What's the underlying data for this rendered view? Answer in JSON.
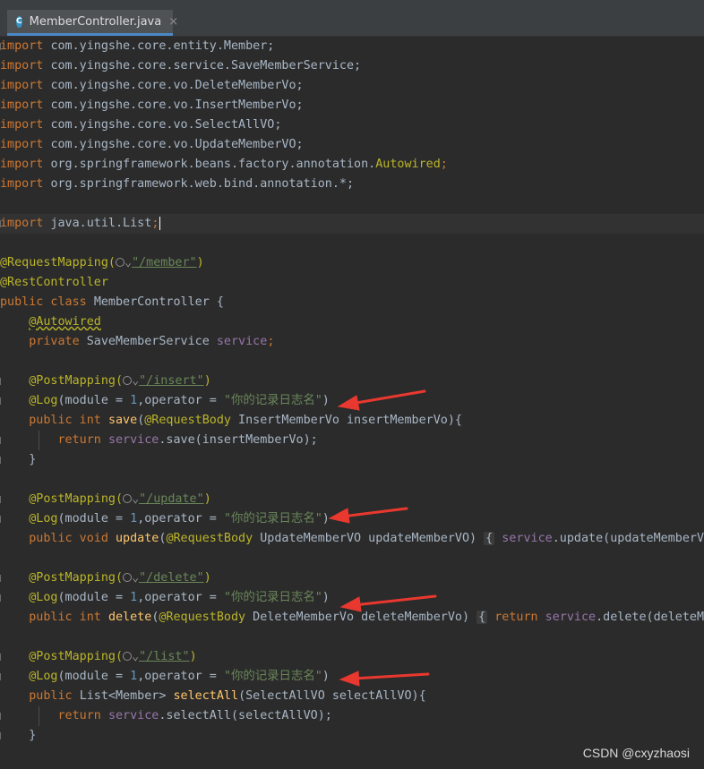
{
  "tab": {
    "label": "MemberController.java",
    "icon": "class-c-icon",
    "close": "×"
  },
  "code": {
    "import_kw": "import",
    "imports": [
      "com.yingshe.core.entity.Member;",
      "com.yingshe.core.service.SaveMemberService;",
      "com.yingshe.core.vo.DeleteMemberVo;",
      "com.yingshe.core.vo.InsertMemberVo;",
      "com.yingshe.core.vo.SelectAllVO;",
      "com.yingshe.core.vo.UpdateMemberVO;"
    ],
    "import_autowired_pkg": "org.springframework.beans.factory.annotation.",
    "import_autowired_cls": "Autowired",
    "import_autowired_semi": ";",
    "import_web": "org.springframework.web.bind.annotation.*;",
    "import_list": "java.util.List",
    "import_list_semi": ";",
    "request_mapping": "@RequestMapping(",
    "request_mapping_path": "\"/member\"",
    "close_paren": ")",
    "rest_controller": "@RestController",
    "class_decl_kw": "public class ",
    "class_decl_name": "MemberController {",
    "autowired": "@Autowired",
    "private_kw": "private ",
    "service_type": "SaveMemberService ",
    "service_field": "service",
    "semi": ";",
    "post_mapping": "@PostMapping(",
    "path_insert": "\"/insert\"",
    "path_update": "\"/update\"",
    "path_delete": "\"/delete\"",
    "path_list": "\"/list\"",
    "log_prefix": "@Log",
    "log_module": "(module = ",
    "log_module_num": "1",
    "log_operator": ",operator = ",
    "log_string": "\"你的记录日志名\"",
    "public_int": "public int ",
    "public_void": "public void ",
    "public_kw": "public ",
    "save_fn": "save",
    "save_params_a": "(",
    "request_body": "@RequestBody",
    "save_params_b": " InsertMemberVo insertMemberVo){",
    "return_kw": "return ",
    "save_call": ".save(insertMemberVo);",
    "close_brace": "}",
    "update_fn": "update",
    "update_params": " UpdateMemberVO updateMemberVO)",
    "update_fold": "{",
    "update_call": ".update(updateMemberVO",
    "delete_fn": "delete",
    "delete_params": " DeleteMemberVo deleteMemberVo)",
    "delete_fold": "{",
    "delete_call_kw": "return ",
    "delete_call": ".delete(deleteMe",
    "list_type": "List<Member> ",
    "select_fn": "selectAll",
    "select_params": "(SelectAllVO selectAllVO){",
    "select_call": ".selectAll(selectAllVO);"
  },
  "annotations": {
    "arrow_color": "#e8382f",
    "arrow_count": 4
  },
  "watermark": "CSDN @cxyzhaosi",
  "colors": {
    "keyword": "#cc7832",
    "annotation": "#bbb529",
    "string": "#6a8759",
    "number": "#6897bb",
    "field": "#9876aa",
    "method": "#ffc66d",
    "background": "#2b2b2b"
  }
}
